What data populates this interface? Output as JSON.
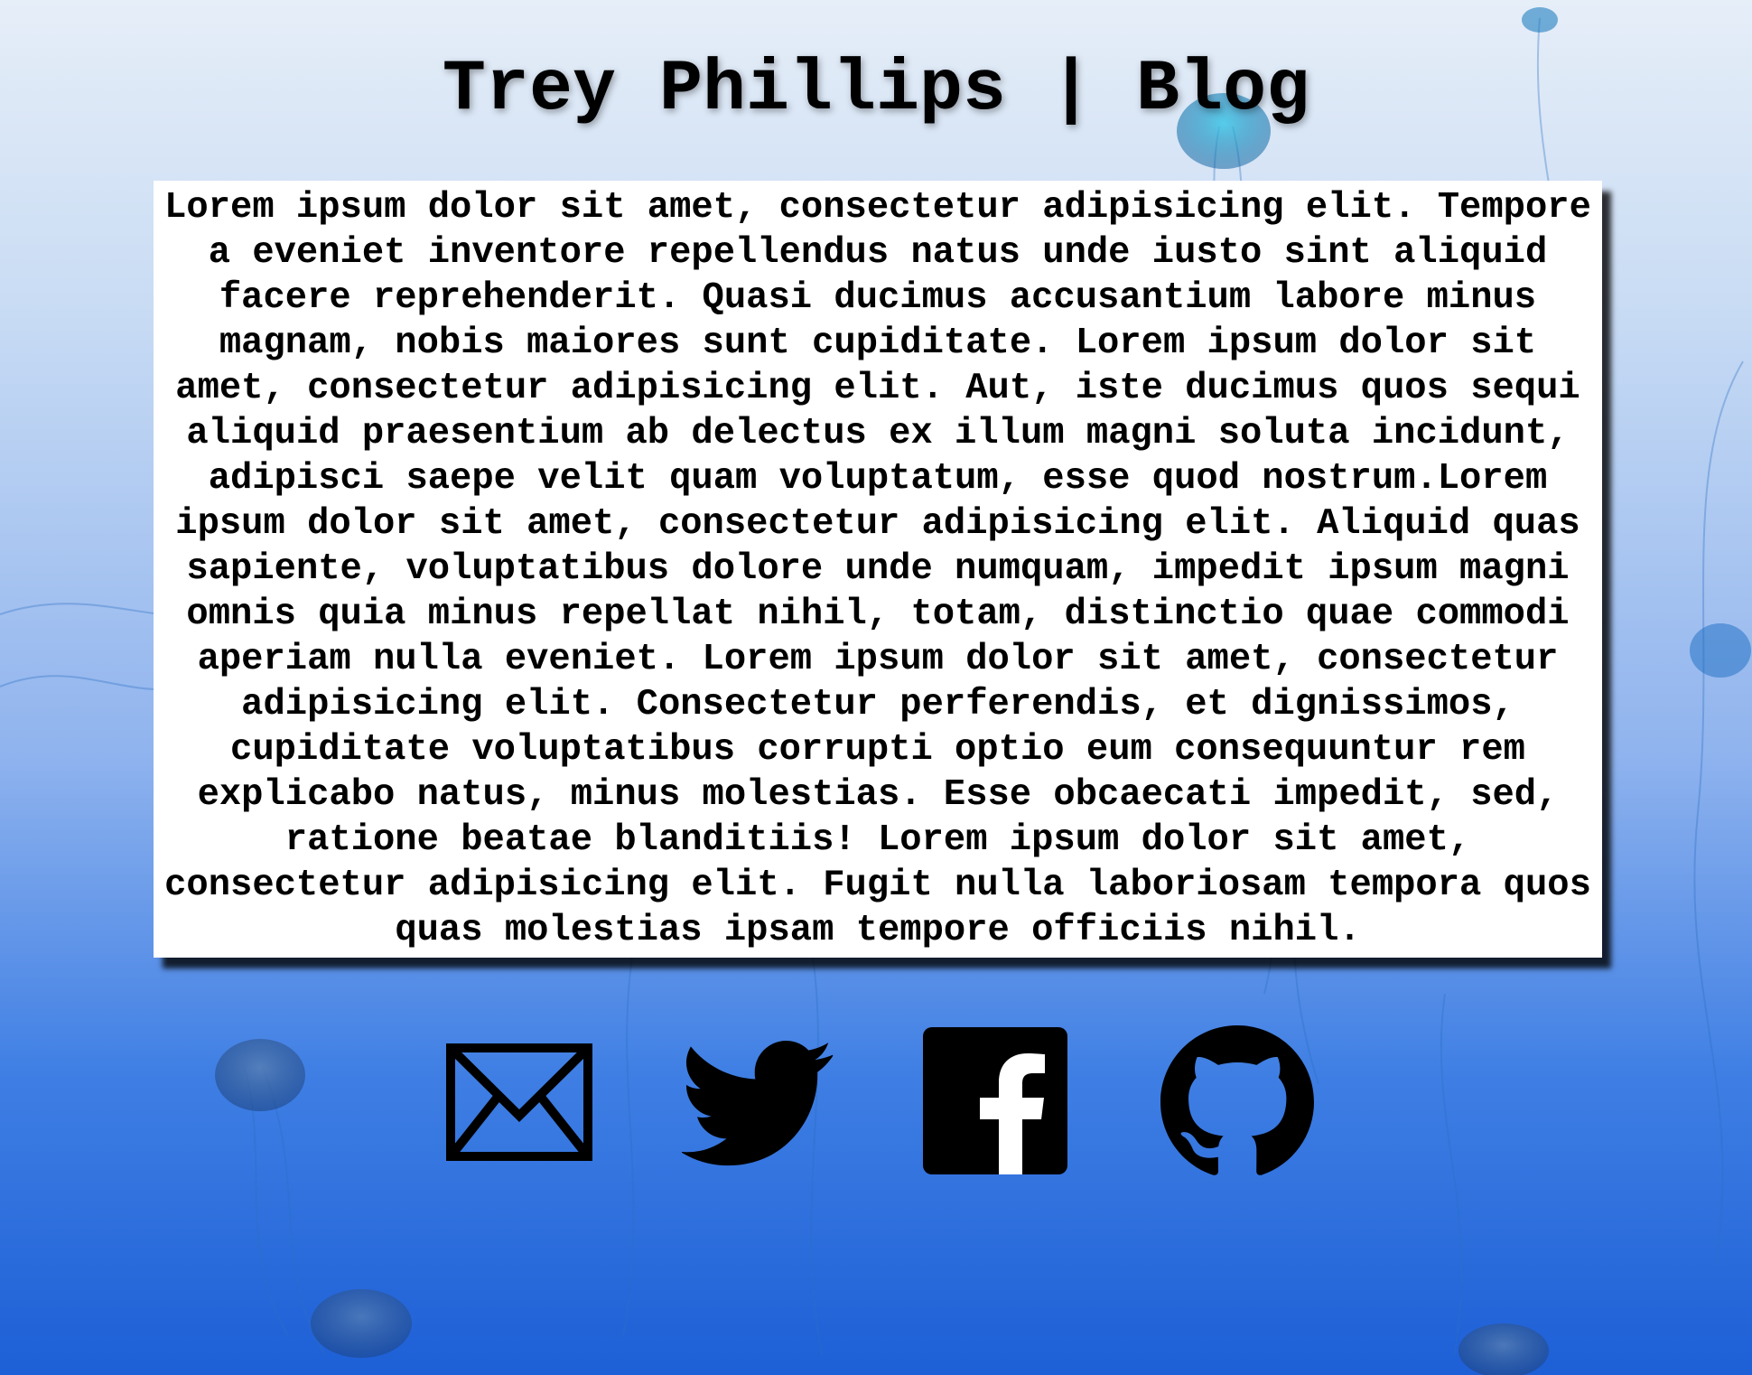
{
  "header": {
    "title": "Trey Phillips | Blog"
  },
  "post": {
    "body": "Lorem ipsum dolor sit amet, consectetur adipisicing elit. Tempore a eveniet inventore repellendus natus unde iusto sint aliquid facere reprehenderit. Quasi ducimus accusantium labore minus magnam, nobis maiores sunt cupiditate. Lorem ipsum dolor sit amet, consectetur adipisicing elit. Aut, iste ducimus quos sequi aliquid praesentium ab delectus ex illum magni soluta incidunt, adipisci saepe velit quam voluptatum, esse quod nostrum.Lorem ipsum dolor sit amet, consectetur adipisicing elit. Aliquid quas sapiente, voluptatibus dolore unde numquam, impedit ipsum magni omnis quia minus repellat nihil, totam, distinctio quae commodi aperiam nulla eveniet. Lorem ipsum dolor sit amet, consectetur adipisicing elit. Consectetur perferendis, et dignissimos, cupiditate voluptatibus corrupti optio eum consequuntur rem explicabo natus, minus molestias. Esse obcaecati impedit, sed, ratione beatae blanditiis! Lorem ipsum dolor sit amet, consectetur adipisicing elit. Fugit nulla laboriosam tempora quos quas molestias ipsam tempore officiis nihil."
  },
  "social": {
    "icons": [
      "envelope-icon",
      "twitter-bird-icon",
      "facebook-icon",
      "github-octocat-icon"
    ],
    "icon_color": "#000000"
  },
  "theme": {
    "background_top": "#e6eef8",
    "background_bottom": "#1d5fd6",
    "card_background": "#ffffff"
  }
}
